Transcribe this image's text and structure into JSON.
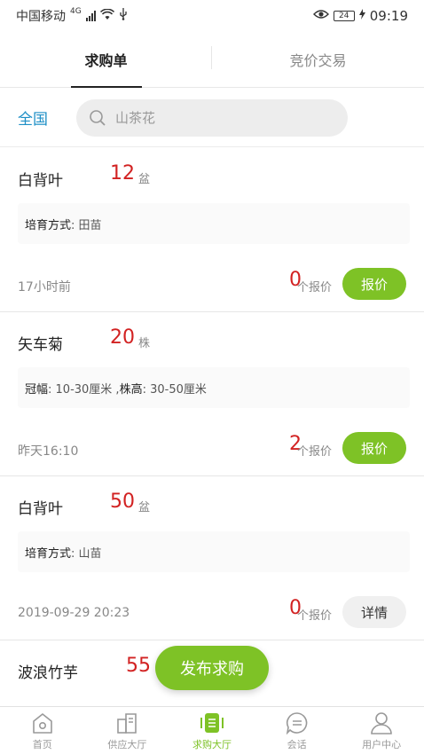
{
  "status_bar": {
    "carrier": "中国移动",
    "network": "4G",
    "battery": "24",
    "time": "09:19"
  },
  "tabs": [
    {
      "label": "求购单",
      "active": true
    },
    {
      "label": "竞价交易",
      "active": false
    }
  ],
  "search": {
    "region": "全国",
    "placeholder": "山茶花"
  },
  "listings": [
    {
      "name": "白背叶",
      "qty": "12",
      "unit": "盆",
      "spec_key": "培育方式",
      "spec_value": ": 田苗",
      "time": "17小时前",
      "quote_count": "0",
      "quote_label": "个报价",
      "button_label": "报价",
      "button_style": "primary"
    },
    {
      "name": "矢车菊",
      "qty": "20",
      "unit": "株",
      "spec_key": "冠幅",
      "spec_value": ": 10-30厘米 ,",
      "spec_key2": "株高",
      "spec_value2": ": 30-50厘米",
      "time": "昨天16:10",
      "quote_count": "2",
      "quote_label": "个报价",
      "button_label": "报价",
      "button_style": "primary"
    },
    {
      "name": "白背叶",
      "qty": "50",
      "unit": "盆",
      "spec_key": "培育方式",
      "spec_value": ": 山苗",
      "time": "2019-09-29 20:23",
      "quote_count": "0",
      "quote_label": "个报价",
      "button_label": "详情",
      "button_style": "secondary"
    },
    {
      "name": "波浪竹芋",
      "qty": "55"
    }
  ],
  "fab": {
    "label": "发布求购"
  },
  "bottom_nav": [
    {
      "label": "首页",
      "icon": "home-icon"
    },
    {
      "label": "供应大厅",
      "icon": "supply-hall-icon"
    },
    {
      "label": "求购大厅",
      "icon": "purchase-hall-icon",
      "active": true
    },
    {
      "label": "会话",
      "icon": "chat-icon"
    },
    {
      "label": "用户中心",
      "icon": "user-icon"
    }
  ],
  "colors": {
    "accent_green": "#7ec226",
    "price_red": "#d22222",
    "region_blue": "#1e8fc6"
  }
}
